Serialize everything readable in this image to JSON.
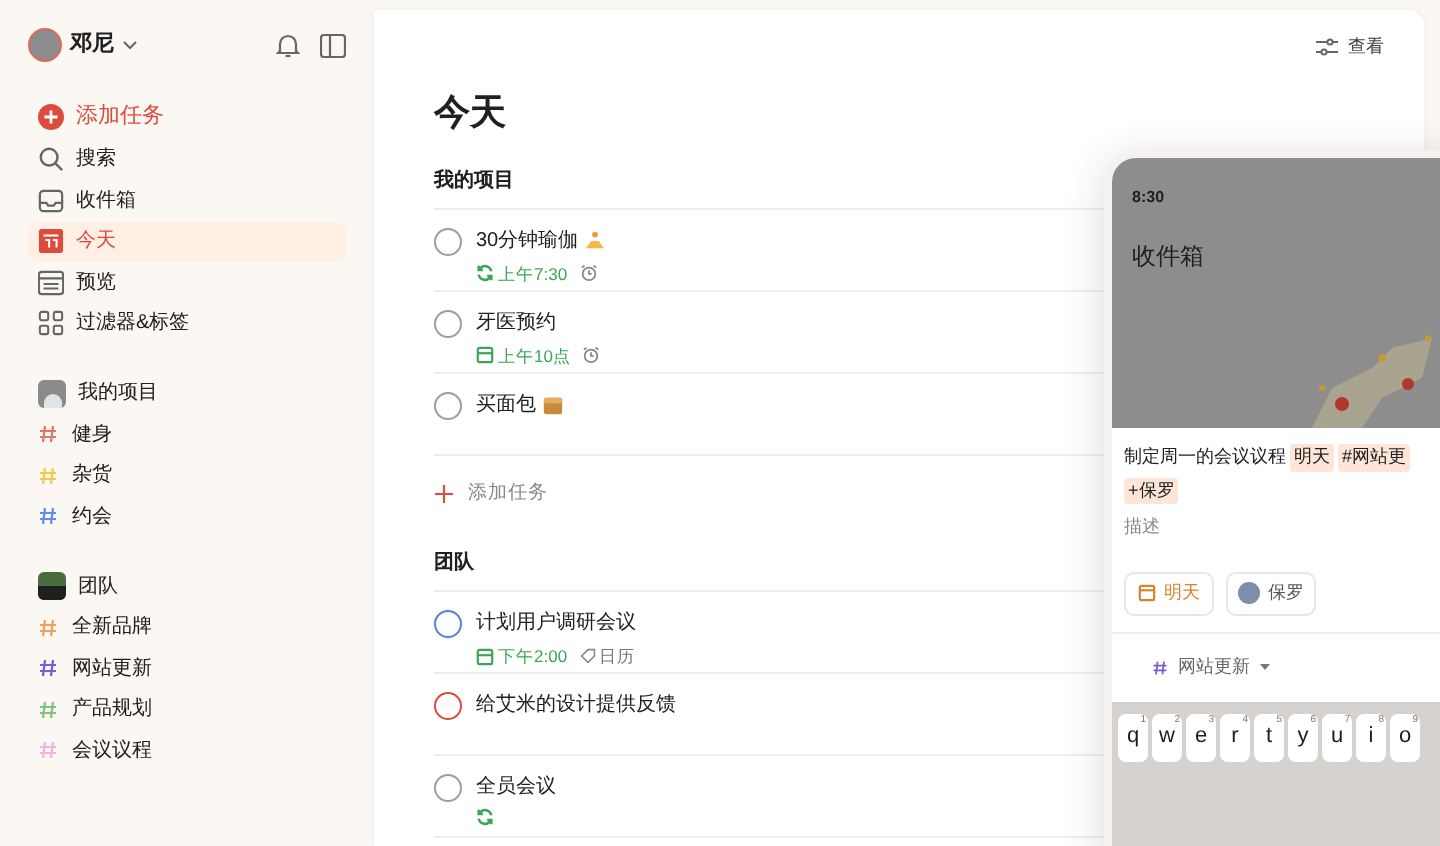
{
  "user": {
    "name": "邓尼"
  },
  "sidebar": {
    "add_task": "添加任务",
    "nav": [
      {
        "label": "搜索",
        "selected": false
      },
      {
        "label": "收件箱",
        "selected": false
      },
      {
        "label": "今天",
        "selected": true
      },
      {
        "label": "预览",
        "selected": false
      },
      {
        "label": "过滤器&标签",
        "selected": false
      }
    ],
    "groups": [
      {
        "kind": "personal",
        "title": "我的项目",
        "projects": [
          {
            "name": "健身",
            "color": "#e0736b"
          },
          {
            "name": "杂货",
            "color": "#f5c842"
          },
          {
            "name": "约会",
            "color": "#5b8def"
          }
        ]
      },
      {
        "kind": "team",
        "title": "团队",
        "projects": [
          {
            "name": "全新品牌",
            "color": "#f0a05a"
          },
          {
            "name": "网站更新",
            "color": "#7a5ad6"
          },
          {
            "name": "产品规划",
            "color": "#7cc47f"
          },
          {
            "name": "会议议程",
            "color": "#f0b3e0"
          }
        ]
      }
    ]
  },
  "header": {
    "view_button": "查看"
  },
  "page_title": "今天",
  "sections": [
    {
      "title": "我的项目",
      "tasks": [
        {
          "kind": "yoga",
          "title": "30分钟瑜伽",
          "color": "#9e9e9e",
          "due": {
            "kind": "recurring",
            "text": "上午7:30"
          },
          "alarm": true
        },
        {
          "kind": "plain",
          "title": "牙医预约",
          "color": "#9e9e9e",
          "due": {
            "kind": "date",
            "text": "上午10点"
          },
          "alarm": true
        },
        {
          "kind": "box",
          "title": "买面包",
          "color": "#9e9e9e",
          "alarm": false
        }
      ],
      "add_task": "添加任务"
    },
    {
      "title": "团队",
      "tasks": [
        {
          "kind": "plain",
          "title": "计划用户调研会议",
          "color": "#4a84f0",
          "due": {
            "kind": "date",
            "text": "下午2:00"
          },
          "alarm": false,
          "label": "日历"
        },
        {
          "kind": "plain",
          "title": "给艾米的设计提供反馈",
          "color": "#dc4c3e",
          "alarm": false
        },
        {
          "kind": "plain",
          "title": "全员会议",
          "color": "#9e9e9e",
          "due": {
            "kind": "recurring"
          },
          "alarm": false
        }
      ]
    }
  ],
  "phone": {
    "time": "8:30",
    "title": "收件箱",
    "composer": {
      "text": "制定周一的会议议程",
      "chips": [
        "明天",
        "#网站更",
        "+保罗"
      ],
      "placeholder": "描述",
      "date_button": "明天",
      "assignee_button": "保罗",
      "project": "网站更新"
    },
    "keys": [
      {
        "key": "q",
        "hint": "1"
      },
      {
        "key": "w",
        "hint": "2"
      },
      {
        "key": "e",
        "hint": "3"
      },
      {
        "key": "r",
        "hint": "4"
      },
      {
        "key": "t",
        "hint": "5"
      },
      {
        "key": "y",
        "hint": "6"
      },
      {
        "key": "u",
        "hint": "7"
      },
      {
        "key": "i",
        "hint": "8"
      },
      {
        "key": "o",
        "hint": "9"
      }
    ]
  }
}
